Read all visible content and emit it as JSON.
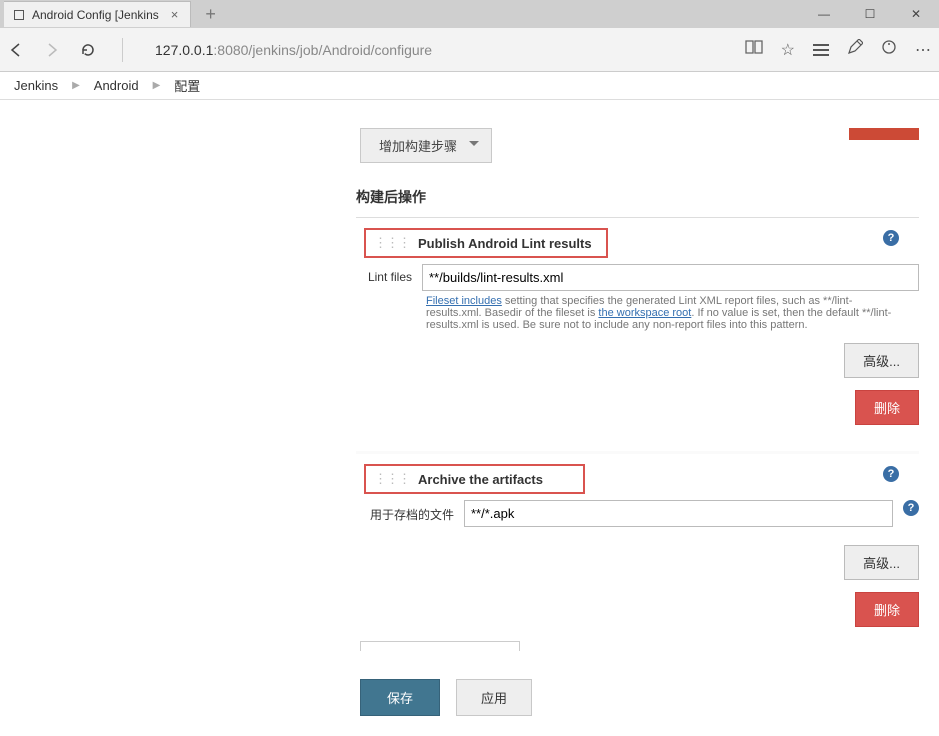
{
  "browser": {
    "tab_title": "Android Config [Jenkins",
    "url_host": "127.0.0.1",
    "url_rest": ":8080/jenkins/job/Android/configure"
  },
  "breadcrumb": {
    "items": [
      "Jenkins",
      "Android",
      "配置"
    ]
  },
  "buttons": {
    "add_build_step": "增加构建步骤",
    "advanced": "高级...",
    "delete": "删除",
    "save": "保存",
    "apply": "应用"
  },
  "sections": {
    "post_build": "构建后操作"
  },
  "block1": {
    "title": "Publish Android Lint results",
    "field_label": "Lint files",
    "field_value": "**/builds/lint-results.xml",
    "desc1_link": "Fileset includes",
    "desc1_mid": " setting that specifies the generated Lint XML report files, such as **/lint-results.xml. Basedir of the fileset is ",
    "desc1_link2": "the workspace root",
    "desc1_tail": ". If no value is set, then the default **/lint-results.xml is used. Be sure not to include any non-report files into this pattern."
  },
  "block2": {
    "title": "Archive the artifacts",
    "field_label": "用于存档的文件",
    "field_value": "**/*.apk"
  }
}
